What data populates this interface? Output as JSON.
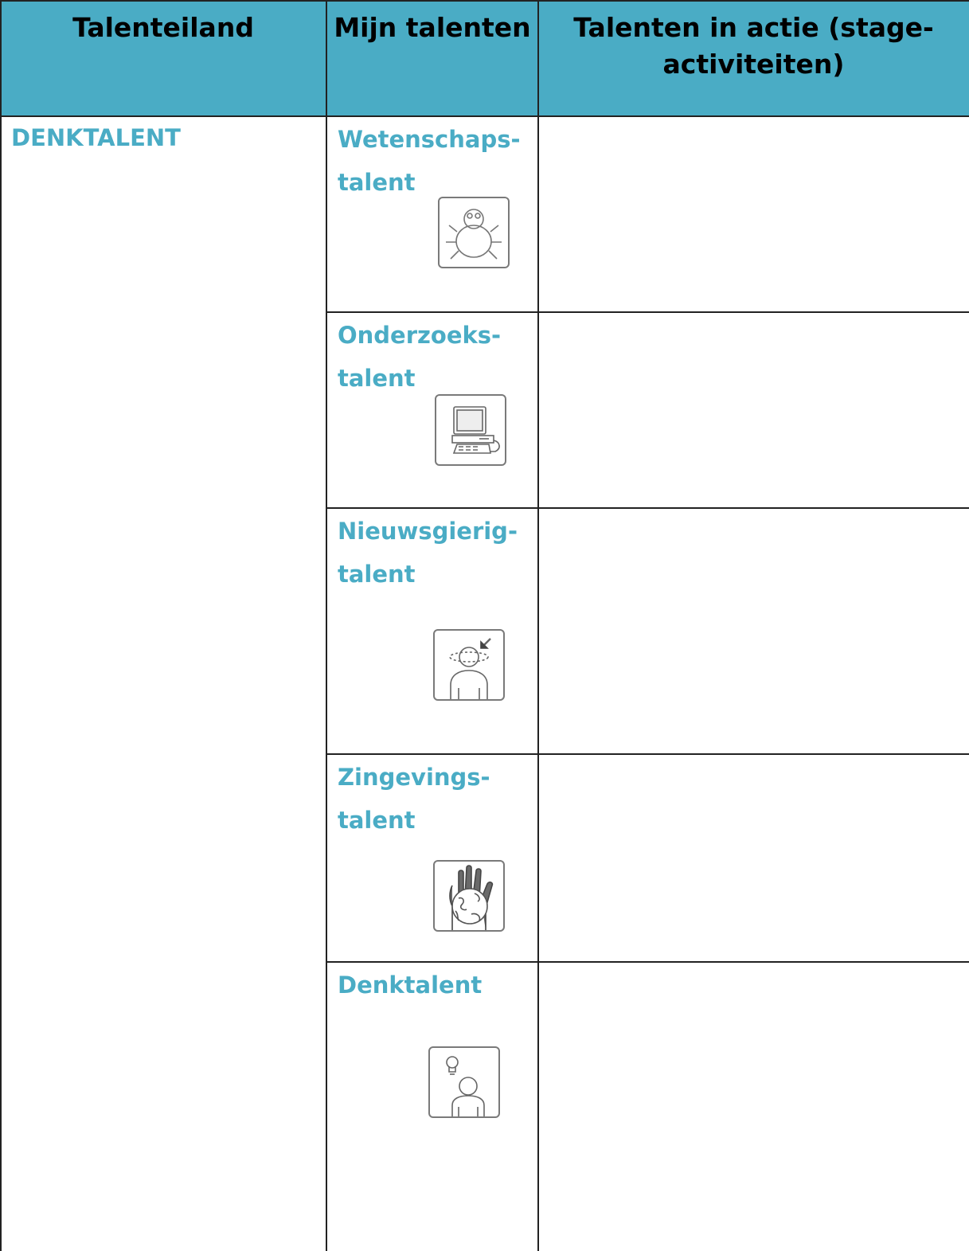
{
  "table": {
    "headers": {
      "island": "Talenteiland",
      "talents": "Mijn talenten",
      "action_line1": "Talenten in actie (stage-",
      "action_line2": "activiteiten)"
    },
    "island_name": "DENKTALENT",
    "rows": [
      {
        "name_line1": "Wetenschaps-",
        "name_line2": "talent",
        "icon": "bug-icon",
        "action": ""
      },
      {
        "name_line1": "Onderzoeks-",
        "name_line2": "talent",
        "icon": "computer-icon",
        "action": ""
      },
      {
        "name_line1": "Nieuwsgierig-",
        "name_line2": "talent",
        "icon": "curious-person-icon",
        "action": ""
      },
      {
        "name_line1": "Zingevings-",
        "name_line2": "talent",
        "icon": "hand-globe-icon",
        "action": ""
      },
      {
        "name_line1": "Denktalent",
        "name_line2": "",
        "icon": "lightbulb-person-icon",
        "action": ""
      }
    ]
  },
  "colors": {
    "header_background": "#4aacc5",
    "talent_text": "#4aacc5",
    "border": "#222222"
  }
}
